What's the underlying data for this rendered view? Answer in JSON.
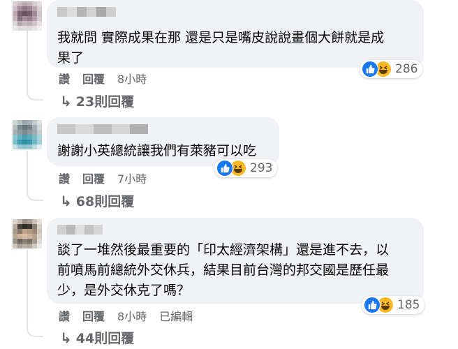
{
  "comments": [
    {
      "text_lines": [
        "我就問 實際成果在那 還是只是嘴皮說說畫個大餅就是成",
        "果了"
      ],
      "reaction_count": "286",
      "actions": {
        "like": "讚",
        "reply": "回覆",
        "time": "8小時"
      },
      "replies_label": "23則回覆"
    },
    {
      "text_lines": [
        "謝謝小英總統讓我們有萊豬可以吃"
      ],
      "reaction_count": "293",
      "actions": {
        "like": "讚",
        "reply": "回覆",
        "time": "7小時"
      },
      "replies_label": "68則回覆"
    },
    {
      "text_lines": [
        "談了一堆然後最重要的「印太經濟架構」還是進不去，以",
        "前噴馬前總統外交休兵，結果目前台灣的邦交國是歷任最",
        "少，是外交休克了嗎？"
      ],
      "reaction_count": "185",
      "actions": {
        "like": "讚",
        "reply": "回覆",
        "time": "8小時",
        "edited": "已編輯"
      },
      "replies_label": "44則回覆"
    }
  ],
  "reaction_icons": [
    "like-icon",
    "haha-icon"
  ],
  "colors": {
    "like": "#1877f2",
    "haha": "#f7b928",
    "bubble": "#f0f2f5",
    "secondary_text": "#65676b"
  }
}
